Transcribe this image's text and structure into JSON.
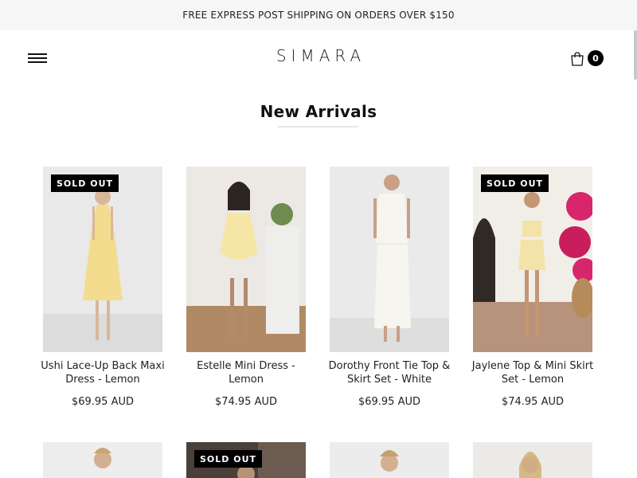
{
  "announcement": "FREE EXPRESS POST SHIPPING ON ORDERS OVER $150",
  "header": {
    "logo": "SIMARA",
    "cart_count": "0"
  },
  "section": {
    "title": "New Arrivals"
  },
  "badge_label": "SOLD OUT",
  "products": [
    {
      "name": "Ushi Lace-Up Back Maxi Dress - Lemon",
      "price": "$69.95 AUD",
      "sold_out": true,
      "colors": {
        "bg": "#e9e9ea",
        "garment": "#f3dc8e"
      }
    },
    {
      "name": "Estelle Mini Dress - Lemon",
      "price": "$74.95 AUD",
      "sold_out": false,
      "colors": {
        "bg": "#ece9e4",
        "garment": "#f6e6a6"
      }
    },
    {
      "name": "Dorothy Front Tie Top & Skirt Set - White",
      "price": "$69.95 AUD",
      "sold_out": false,
      "colors": {
        "bg": "#eaeaea",
        "garment": "#f7f5ef"
      }
    },
    {
      "name": "Jaylene Top & Mini Skirt Set - Lemon",
      "price": "$74.95 AUD",
      "sold_out": true,
      "colors": {
        "bg": "#e8e2d6",
        "garment": "#f3e3a8"
      }
    }
  ],
  "row2": [
    {
      "sold_out": false
    },
    {
      "sold_out": true
    },
    {
      "sold_out": false
    },
    {
      "sold_out": false
    }
  ]
}
